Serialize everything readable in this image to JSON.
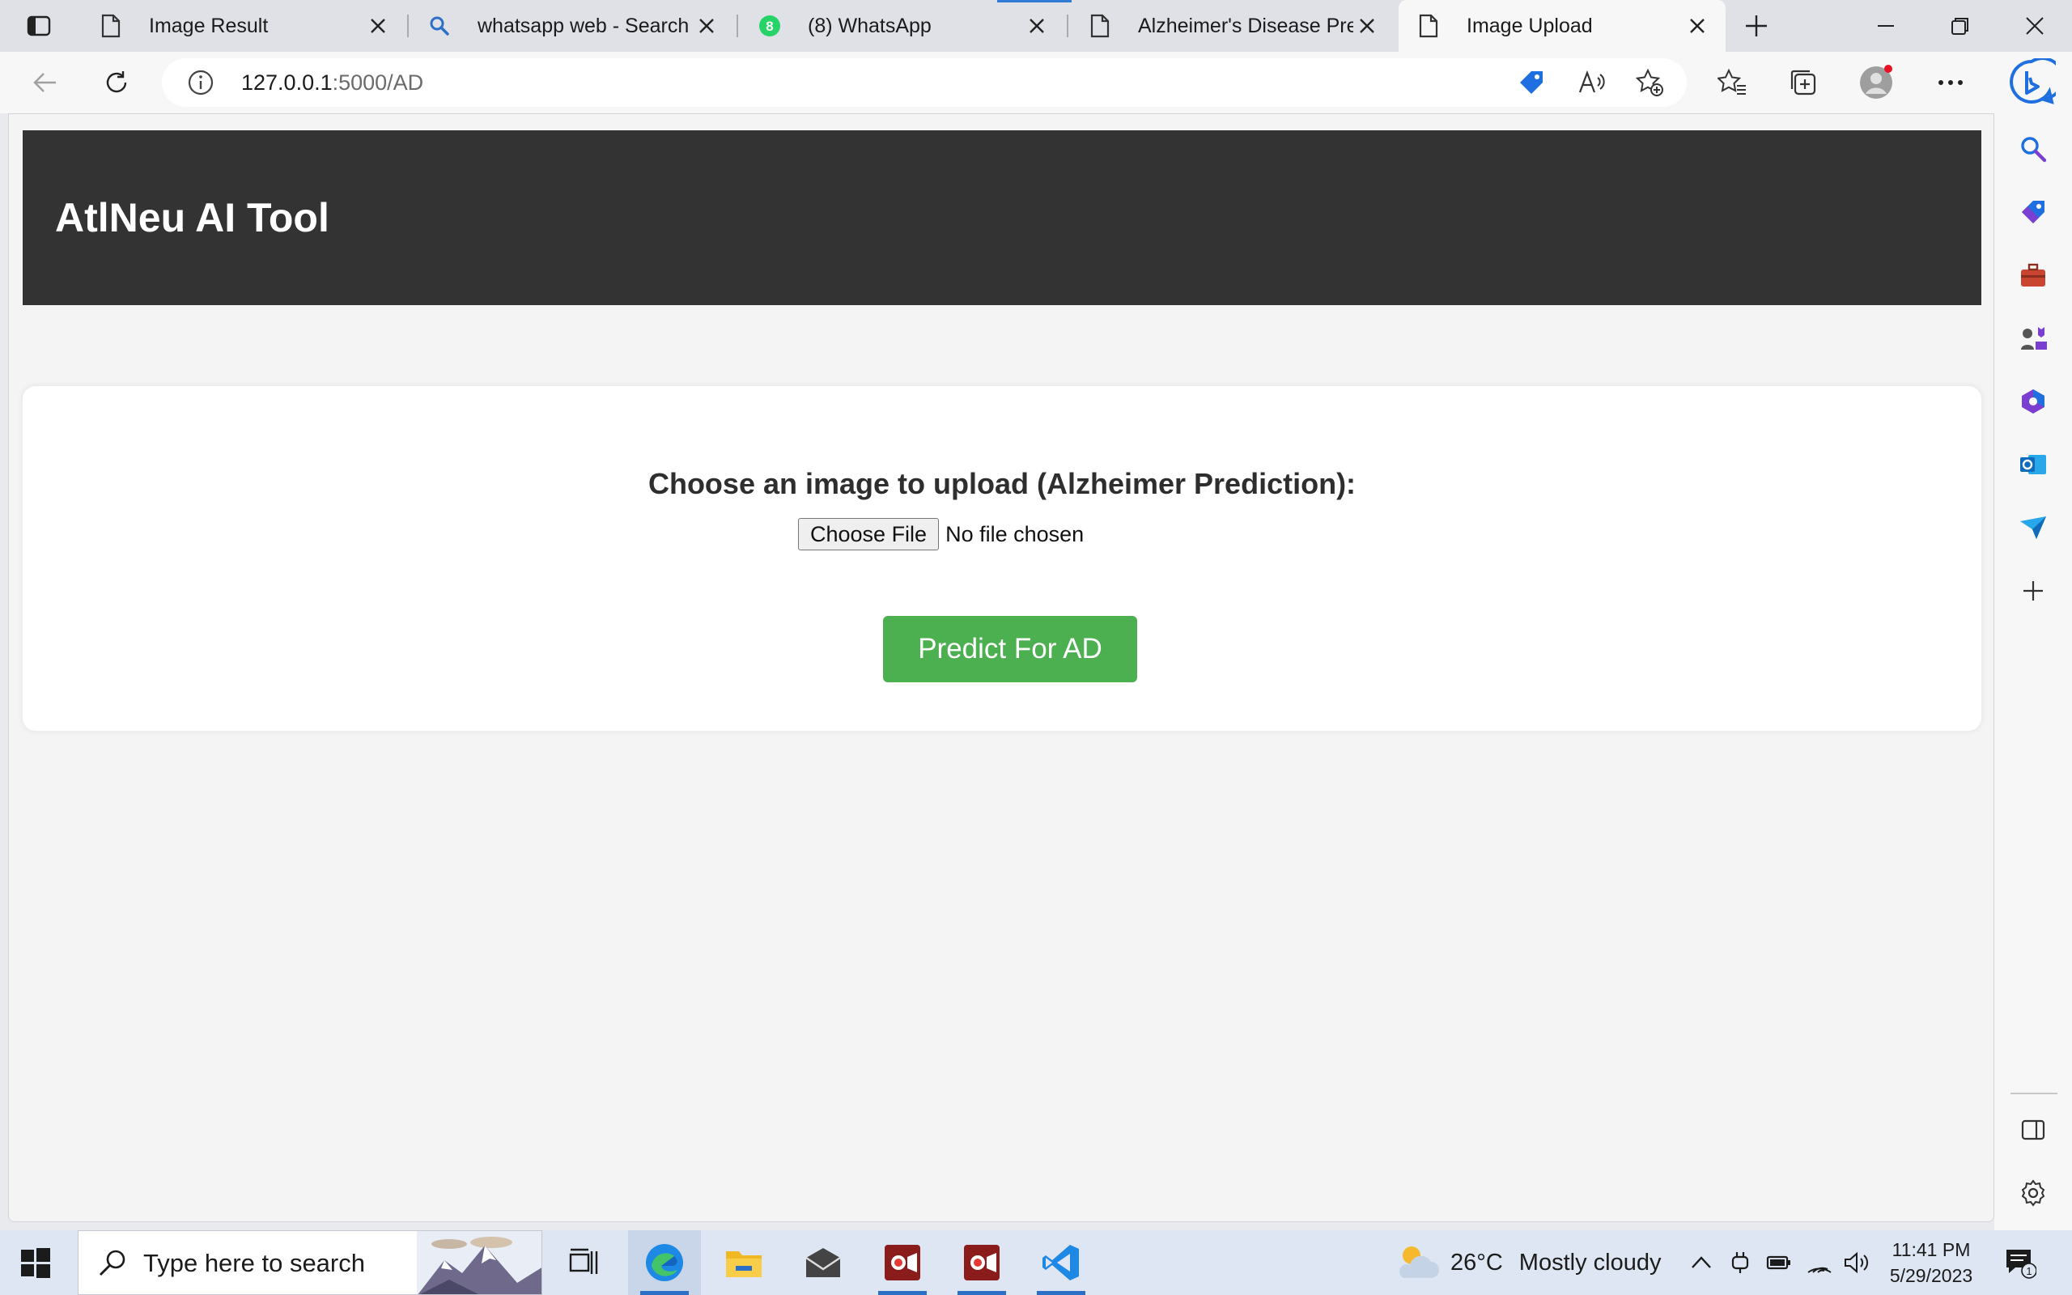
{
  "browser": {
    "tabs": [
      {
        "title": "Image Result",
        "icon": "page-icon"
      },
      {
        "title": "whatsapp web - Search",
        "icon": "search-icon"
      },
      {
        "title": "(8) WhatsApp",
        "icon": "whatsapp-icon",
        "badge": "8"
      },
      {
        "title": "Alzheimer's Disease Predic",
        "icon": "page-icon"
      },
      {
        "title": "Image Upload",
        "icon": "page-icon",
        "active": true
      }
    ],
    "address": {
      "host": "127.0.0.1",
      "path": ":5000/AD"
    }
  },
  "page": {
    "site_title": "AtlNeu AI Tool",
    "upload_label": "Choose an image to upload (Alzheimer Prediction):",
    "file_button": "Choose File",
    "file_status": "No file chosen",
    "predict_button": "Predict For AD"
  },
  "taskbar": {
    "search_placeholder": "Type here to search",
    "weather_temp": "26°C",
    "weather_condition": "Mostly cloudy",
    "time": "11:41 PM",
    "date": "5/29/2023",
    "notification_count": "1"
  },
  "colors": {
    "header_bg": "#333333",
    "predict_button_bg": "#4caf50",
    "page_bg": "#f4f4f4",
    "accent": "#2b6fc7"
  }
}
